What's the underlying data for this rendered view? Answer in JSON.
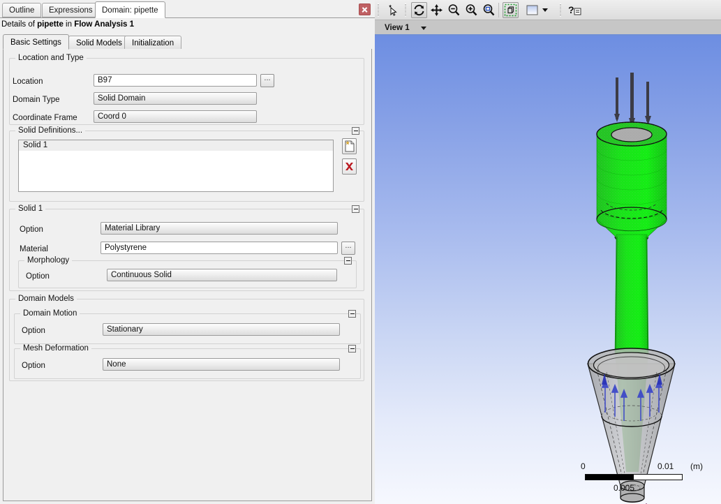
{
  "window": {
    "outer_tabs": [
      {
        "label": "Outline",
        "active": false
      },
      {
        "label": "Expressions",
        "active": false
      },
      {
        "label": "Domain: pipette",
        "active": true
      }
    ],
    "close_icon": "close-icon"
  },
  "details": {
    "prefix": "Details of ",
    "object": "pipette",
    "middle": " in ",
    "analysis": "Flow Analysis 1"
  },
  "inner_tabs": [
    {
      "label": "Basic Settings",
      "active": true
    },
    {
      "label": "Solid Models",
      "active": false
    },
    {
      "label": "Initialization",
      "active": false
    }
  ],
  "location_and_type": {
    "title": "Location and Type",
    "fields": [
      {
        "label": "Location",
        "value": "B97",
        "style": "white",
        "has_browse": true
      },
      {
        "label": "Domain Type",
        "value": "Solid Domain",
        "style": "grey",
        "has_browse": false
      },
      {
        "label": "Coordinate Frame",
        "value": "Coord 0",
        "style": "grey",
        "has_browse": false
      }
    ]
  },
  "solid_definitions": {
    "title": "Solid Definitions...",
    "items": [
      "Solid 1"
    ],
    "new_button_icon": "new-document-icon",
    "delete_button_icon": "delete-x-icon"
  },
  "solid_1": {
    "title": "Solid 1",
    "option_label": "Option",
    "option_value": "Material Library",
    "material_label": "Material",
    "material_value": "Polystyrene",
    "morphology": {
      "title": "Morphology",
      "option_label": "Option",
      "option_value": "Continuous Solid"
    }
  },
  "domain_models": {
    "title": "Domain Models",
    "domain_motion": {
      "title": "Domain Motion",
      "option_label": "Option",
      "option_value": "Stationary"
    },
    "mesh_deformation": {
      "title": "Mesh Deformation",
      "option_label": "Option",
      "option_value": "None"
    }
  },
  "toolbar": {
    "buttons": [
      {
        "name": "select-pick-icon",
        "active": false
      },
      {
        "name": "rotate-icon",
        "active": true
      },
      {
        "name": "pan-icon",
        "active": false
      },
      {
        "name": "zoom-out-icon",
        "active": false
      },
      {
        "name": "zoom-in-icon",
        "active": false
      },
      {
        "name": "zoom-box-icon",
        "active": false
      },
      {
        "name": "fit-view-icon",
        "active": true
      },
      {
        "name": "background-color-icon",
        "active": false
      },
      {
        "name": "help-icon",
        "active": false
      }
    ]
  },
  "viewbar": {
    "label": "View 1",
    "dropdown_icon": "chevron-down-icon"
  },
  "scale_legend": {
    "min": "0",
    "max": "0.01",
    "unit": "(m)",
    "mid": "0.005"
  }
}
